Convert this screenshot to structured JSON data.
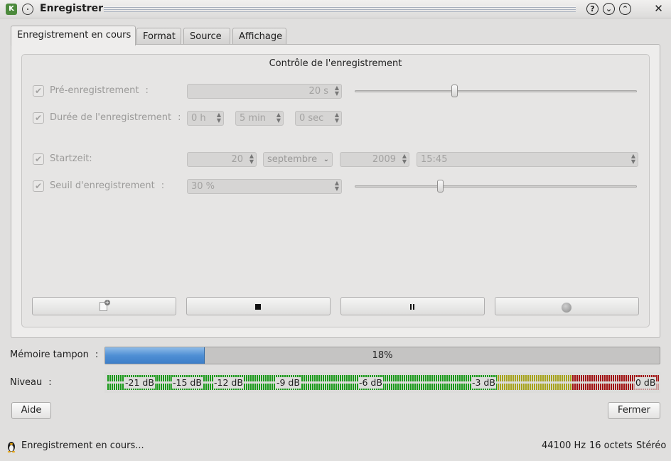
{
  "window": {
    "title": "Enregistrer",
    "app_icon": "k3b-icon",
    "help_label": "?",
    "minimize_label": "⌄",
    "maximize_label": "⌃",
    "close_label": "✕"
  },
  "tabs": [
    {
      "label": "Enregistrement en cours",
      "active": true
    },
    {
      "label": "Format",
      "active": false
    },
    {
      "label": "Source",
      "active": false
    },
    {
      "label": "Affichage",
      "active": false
    }
  ],
  "group": {
    "title": "Contrôle de l'enregistrement",
    "pre_record": {
      "label": "Pré-enregistrement",
      "colon": ":",
      "checked": true,
      "value": "20 s",
      "slider_fraction": 0.35
    },
    "duration": {
      "label": "Durée de l'enregistrement",
      "colon": ":",
      "checked": true,
      "hours": "0 h",
      "minutes": "5 min",
      "seconds": "0 sec"
    },
    "start": {
      "label": "Startzeit:",
      "checked": true,
      "day": "20",
      "month": "septembre",
      "year": "2009",
      "time": "15:45"
    },
    "threshold": {
      "label": "Seuil d'enregistrement",
      "colon": ":",
      "checked": true,
      "value": "30 %",
      "slider_fraction": 0.3
    }
  },
  "buffer": {
    "label": "Mémoire tampon",
    "colon": ":",
    "percent_text": "18%",
    "fraction": 0.18
  },
  "level": {
    "label": "Niveau",
    "colon": ":",
    "marks": [
      "-21 dB",
      "-15 dB",
      "-12 dB",
      "-9 dB",
      "-6 dB",
      "-3 dB",
      "0 dB"
    ]
  },
  "colors": {
    "meter_green": "#1a9a1a",
    "meter_yellow": "#a6a31a",
    "meter_red": "#a01010",
    "accent_blue": "#4f8fd4"
  },
  "footer": {
    "help_button": "Aide",
    "close_button": "Fermer"
  },
  "status": {
    "text": "Enregistrement en cours...",
    "sample_rate": "44100 Hz",
    "bits": "16 octets",
    "channels": "Stéréo"
  }
}
